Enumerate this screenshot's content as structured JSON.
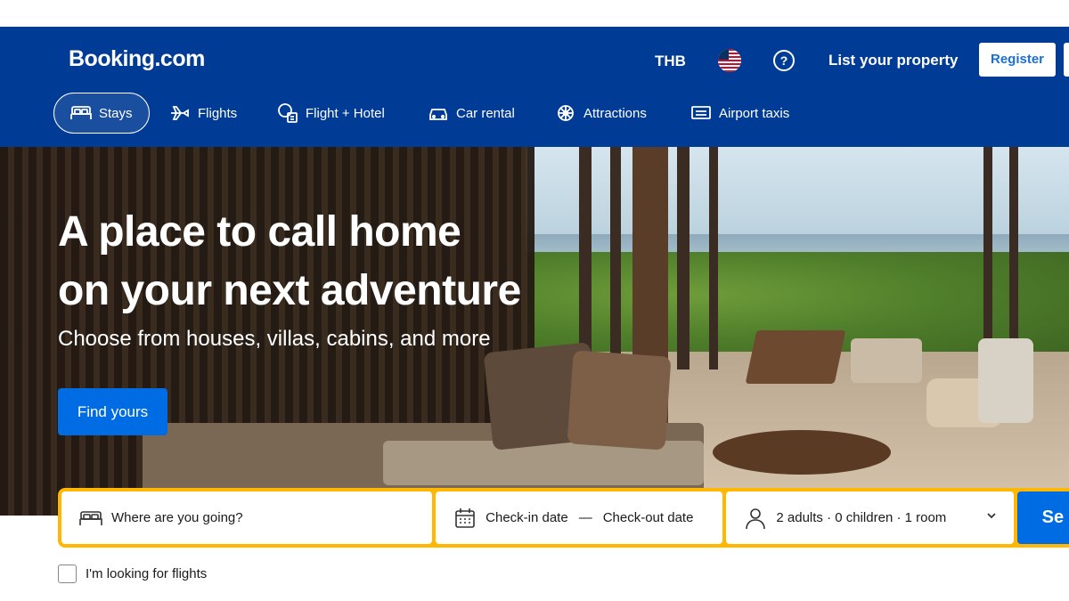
{
  "header": {
    "logo": "Booking.com",
    "currency": "THB",
    "list_property": "List your property",
    "register": "Register"
  },
  "nav": [
    {
      "label": "Stays",
      "icon": "bed-icon",
      "active": true
    },
    {
      "label": "Flights",
      "icon": "plane-icon"
    },
    {
      "label": "Flight + Hotel",
      "icon": "flight-hotel-icon"
    },
    {
      "label": "Car rental",
      "icon": "car-icon"
    },
    {
      "label": "Attractions",
      "icon": "attractions-icon"
    },
    {
      "label": "Airport taxis",
      "icon": "taxi-icon"
    }
  ],
  "hero": {
    "title_line1": "A place to call home",
    "title_line2": "on your next adventure",
    "subtitle": "Choose from houses, villas, cabins, and more",
    "cta": "Find yours"
  },
  "search": {
    "destination_placeholder": "Where are you going?",
    "checkin": "Check-in date",
    "separator": "—",
    "checkout": "Check-out date",
    "guests": "2 adults · 0 children · 1 room",
    "submit": "Se"
  },
  "flights_option": "I'm looking for flights",
  "colors": {
    "brand_blue": "#003b95",
    "action_blue": "#006ce4",
    "search_border": "#ffb700"
  }
}
